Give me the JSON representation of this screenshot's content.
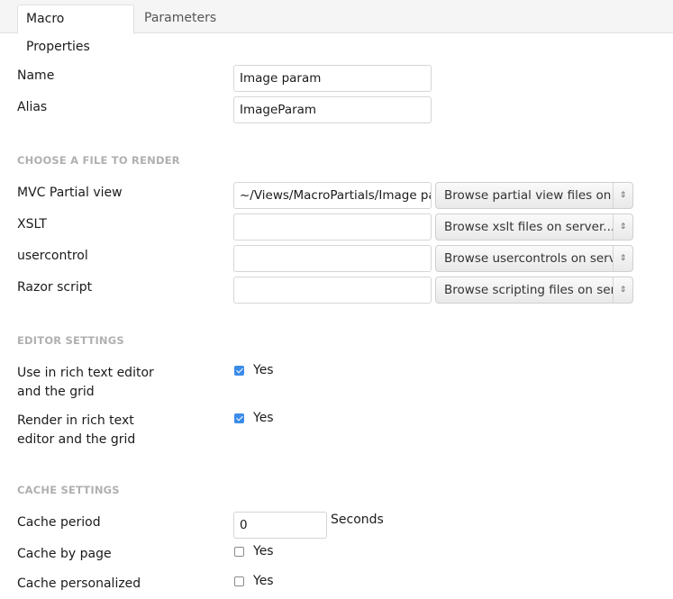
{
  "tabs": [
    {
      "label": "Macro Properties",
      "active": true
    },
    {
      "label": "Parameters",
      "active": false
    }
  ],
  "basic": {
    "name_label": "Name",
    "name_value": "Image param",
    "alias_label": "Alias",
    "alias_value": "ImageParam"
  },
  "render": {
    "section_title": "CHOOSE A FILE TO RENDER",
    "rows": [
      {
        "label": "MVC Partial view",
        "value": "~/Views/MacroPartials/Image param.cshtml",
        "browse": "Browse partial view files on server..."
      },
      {
        "label": "XSLT",
        "value": "",
        "browse": "Browse xslt files on server..."
      },
      {
        "label": "usercontrol",
        "value": "",
        "browse": "Browse usercontrols on server..."
      },
      {
        "label": "Razor script",
        "value": "",
        "browse": "Browse scripting files on server..."
      }
    ]
  },
  "editor": {
    "section_title": "EDITOR SETTINGS",
    "use_in_rte_label_line1": "Use in rich text editor",
    "use_in_rte_label_line2": "and the grid",
    "use_in_rte_checked": true,
    "use_in_rte_option": "Yes",
    "render_in_rte_label_line1": "Render in rich text",
    "render_in_rte_label_line2": "editor and the grid",
    "render_in_rte_checked": true,
    "render_in_rte_option": "Yes"
  },
  "cache": {
    "section_title": "CACHE SETTINGS",
    "period_label": "Cache period",
    "period_value": "0",
    "period_unit": "Seconds",
    "by_page_label": "Cache by page",
    "by_page_checked": false,
    "by_page_option": "Yes",
    "personalized_label": "Cache personalized",
    "personalized_checked": false,
    "personalized_option": "Yes"
  },
  "colors": {
    "accent": "#3b8bea",
    "section_heading": "#b0b0b0"
  }
}
